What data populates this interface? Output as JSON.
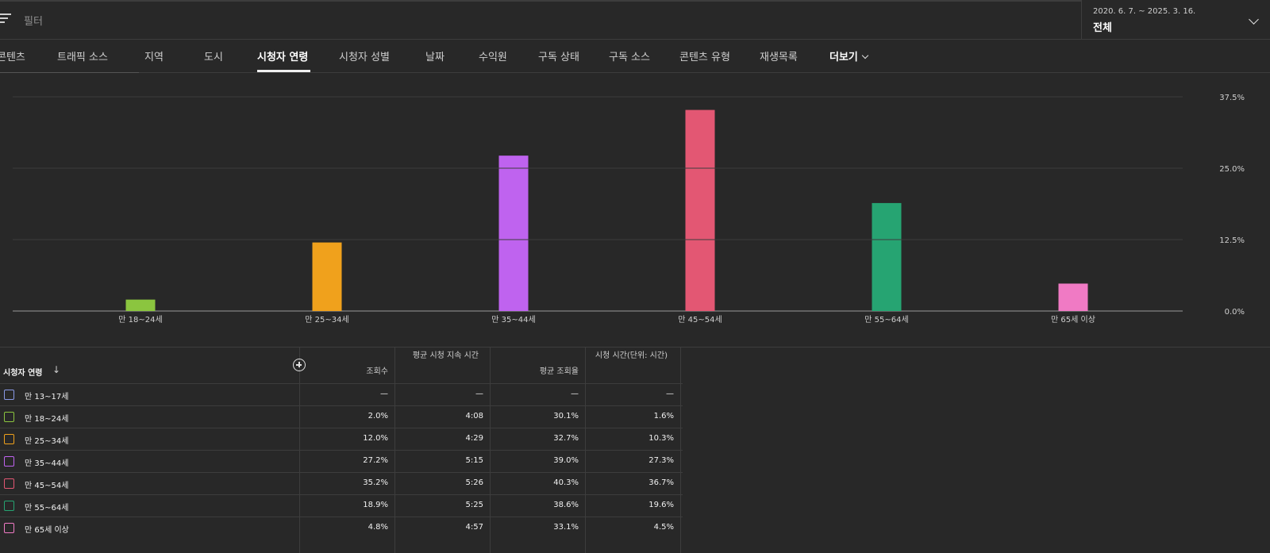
{
  "filter": {
    "label": "필터"
  },
  "date": {
    "range": "2020. 6. 7. ~ 2025. 3. 16.",
    "value": "전체"
  },
  "tabs": [
    {
      "label": "콘텐츠"
    },
    {
      "label": "트래픽 소스"
    },
    {
      "label": "지역"
    },
    {
      "label": "도시"
    },
    {
      "label": "시청자 연령",
      "active": true
    },
    {
      "label": "시청자 성별"
    },
    {
      "label": "날짜"
    },
    {
      "label": "수익원"
    },
    {
      "label": "구독 상태"
    },
    {
      "label": "구독 소스"
    },
    {
      "label": "콘텐츠 유형"
    },
    {
      "label": "재생목록"
    },
    {
      "label": "더보기"
    }
  ],
  "chart_data": {
    "type": "bar",
    "categories": [
      "만 18~24세",
      "만 25~34세",
      "만 35~44세",
      "만 45~54세",
      "만 55~64세",
      "만 65세 이상"
    ],
    "values": [
      2.0,
      12.0,
      27.2,
      35.2,
      18.9,
      4.8
    ],
    "colors": [
      "#8bc53f",
      "#f0a11c",
      "#bf63ef",
      "#e35773",
      "#26a472",
      "#f07ac4"
    ],
    "yticks": [
      "0.0%",
      "12.5%",
      "25.0%",
      "37.5%"
    ],
    "ylim": [
      0,
      37.5
    ],
    "grid": true
  },
  "table": {
    "columns": [
      "시청자 연령",
      "조회수",
      "평균 시청 지속 시간",
      "평균 조회율",
      "시청 시간(단위: 시간)"
    ],
    "rows": [
      {
        "label": "만 13~17세",
        "color": "#8a9ae6",
        "views": "—",
        "avg_duration": "—",
        "avg_rate": "—",
        "watch_time": "—"
      },
      {
        "label": "만 18~24세",
        "color": "#8bc53f",
        "views": "2.0%",
        "avg_duration": "4:08",
        "avg_rate": "30.1%",
        "watch_time": "1.6%"
      },
      {
        "label": "만 25~34세",
        "color": "#f0a11c",
        "views": "12.0%",
        "avg_duration": "4:29",
        "avg_rate": "32.7%",
        "watch_time": "10.3%"
      },
      {
        "label": "만 35~44세",
        "color": "#bf63ef",
        "views": "27.2%",
        "avg_duration": "5:15",
        "avg_rate": "39.0%",
        "watch_time": "27.3%"
      },
      {
        "label": "만 45~54세",
        "color": "#e35773",
        "views": "35.2%",
        "avg_duration": "5:26",
        "avg_rate": "40.3%",
        "watch_time": "36.7%"
      },
      {
        "label": "만 55~64세",
        "color": "#26a472",
        "views": "18.9%",
        "avg_duration": "5:25",
        "avg_rate": "38.6%",
        "watch_time": "19.6%"
      },
      {
        "label": "만 65세 이상",
        "color": "#f07ac4",
        "views": "4.8%",
        "avg_duration": "4:57",
        "avg_rate": "33.1%",
        "watch_time": "4.5%"
      }
    ]
  }
}
